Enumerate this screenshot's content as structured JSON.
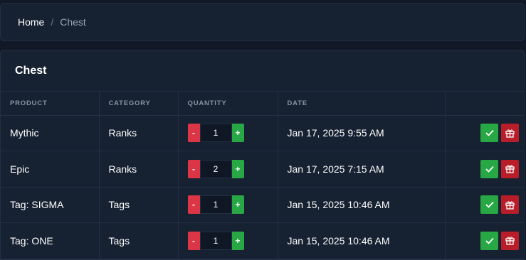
{
  "breadcrumb": {
    "home": "Home",
    "separator": "/",
    "current": "Chest"
  },
  "card": {
    "title": "Chest"
  },
  "table": {
    "headers": {
      "product": "PRODUCT",
      "category": "CATEGORY",
      "quantity": "QUANTITY",
      "date": "DATE",
      "actions": ""
    },
    "rows": [
      {
        "product": "Mythic",
        "category": "Ranks",
        "quantity": "1",
        "date": "Jan 17, 2025 9:55 AM"
      },
      {
        "product": "Epic",
        "category": "Ranks",
        "quantity": "2",
        "date": "Jan 17, 2025 7:15 AM"
      },
      {
        "product": "Tag: SIGMA",
        "category": "Tags",
        "quantity": "1",
        "date": "Jan 15, 2025 10:46 AM"
      },
      {
        "product": "Tag: ONE",
        "category": "Tags",
        "quantity": "1",
        "date": "Jan 15, 2025 10:46 AM"
      }
    ]
  },
  "stepper": {
    "minus": "-",
    "plus": "+"
  },
  "icons": {
    "claim": "check-icon",
    "gift": "gift-icon"
  },
  "colors": {
    "success": "#28a745",
    "danger": "#dc3545",
    "gift": "#b81d2a",
    "background": "#111826",
    "card": "#162131"
  }
}
